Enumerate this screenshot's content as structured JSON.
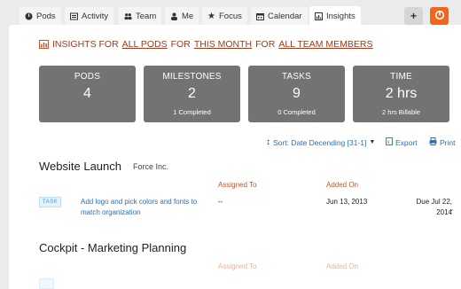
{
  "tabs": [
    {
      "label": "Pods",
      "icon": "pod-icon"
    },
    {
      "label": "Activity",
      "icon": "activity-icon"
    },
    {
      "label": "Team",
      "icon": "team-icon"
    },
    {
      "label": "Me",
      "icon": "user-icon"
    },
    {
      "label": "Focus",
      "icon": "star-icon"
    },
    {
      "label": "Calendar",
      "icon": "calendar-icon"
    },
    {
      "label": "Insights",
      "icon": "chart-icon",
      "active": true
    }
  ],
  "add_button": "+",
  "filter": {
    "prefix": "INSIGHTS FOR ",
    "pods": "ALL PODS",
    "mid1": " FOR ",
    "period": "THIS MONTH",
    "mid2": " FOR ",
    "members": "ALL TEAM MEMBERS"
  },
  "stats": [
    {
      "label": "PODS",
      "value": "4",
      "sub": ""
    },
    {
      "label": "MILESTONES",
      "value": "2",
      "sub": "1 Completed"
    },
    {
      "label": "TASKS",
      "value": "9",
      "sub": "0 Completed"
    },
    {
      "label": "TIME",
      "value": "2 hrs",
      "sub": "2 hrs Billable"
    }
  ],
  "toolbar": {
    "sort": "Sort: Date Decending [31-1]",
    "export": "Export",
    "print": "Print"
  },
  "projects": [
    {
      "title": "Website Launch",
      "client": "Force Inc.",
      "headers": {
        "assigned": "Assigned To",
        "added": "Added On"
      },
      "tasks": [
        {
          "badge": "TASK",
          "name": "Add logo and pick colors and fonts to match organization",
          "assigned": "--",
          "added": "Jun 13, 2013",
          "due_line1": "Due Jul 22,",
          "due_line2": "2014"
        }
      ]
    },
    {
      "title": "Cockpit - Marketing Planning",
      "client": "",
      "headers": {
        "assigned": "Assigned To",
        "added": "Added On"
      },
      "tasks": []
    }
  ],
  "colors": {
    "accent": "#f0661c",
    "link": "#2a6ebc",
    "filter": "#9b3a1c",
    "stat_bg": "#737373",
    "header": "#c0562b"
  }
}
